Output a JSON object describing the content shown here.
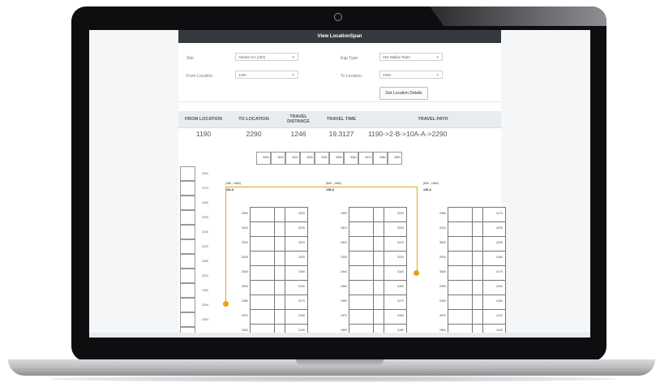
{
  "app": {
    "title": "View LocationSpan"
  },
  "form": {
    "site_label": "Site:",
    "site_value": "Atlanta GA (203)",
    "eqp_type_label": "Eqp Type:",
    "eqp_type_value": "253 Walkie Rider",
    "from_label": "From Location:",
    "from_value": "1190",
    "to_label": "To Location:",
    "to_value": "2290",
    "button_label": "Get Location Details"
  },
  "results": {
    "headers": [
      "FROM LOCATION",
      "TO LOCATION",
      "TRAVEL DISTANCE",
      "TRAVEL TIME",
      "TRAVEL PATH"
    ],
    "row": [
      "1190",
      "2290",
      "1246",
      "19.3127",
      "1190->2-B->10A-A->2290"
    ]
  },
  "map": {
    "top_row": [
      "3401",
      "3411",
      "3421",
      "3431",
      "3441",
      "3451",
      "3461",
      "3471",
      "3481",
      "3491"
    ],
    "left_column": [
      "2303",
      "2273",
      "2263",
      "2293",
      "2240",
      "2220",
      "2205",
      "2210",
      "1900",
      "2294",
      "2293",
      "2270"
    ],
    "coords": [
      {
        "text": "(185 , 1664)",
        "node": "10A-A"
      },
      {
        "text": "(609 , 1664)",
        "node": "10B-A"
      },
      {
        "text": "(609 , 1664)",
        "node": "10E-A"
      }
    ],
    "blocks": [
      {
        "left": [
          "2950",
          "3410",
          "2920",
          "2530",
          "2540",
          "2990",
          "2280",
          "2970",
          "2960"
        ],
        "right": [
          "3220",
          "3230",
          "3210",
          "3220",
          "3160",
          "3100",
          "3170",
          "3180",
          "3190"
        ]
      },
      {
        "left": [
          "1900",
          "1810",
          "1820",
          "1530",
          "1540",
          "1560",
          "1990",
          "1870",
          "1850"
        ],
        "right": [
          "3220",
          "3230",
          "3210",
          "3220",
          "3160",
          "3160",
          "3170",
          "3180",
          "3180"
        ]
      },
      {
        "left": [
          "2950",
          "3410",
          "3820",
          "2530",
          "3540",
          "2990",
          "2280",
          "3970",
          "2860"
        ],
        "right": [
          "4170",
          "4200",
          "4190",
          "4180",
          "4170",
          "4160",
          "4180",
          "4142",
          "4153"
        ]
      }
    ]
  }
}
